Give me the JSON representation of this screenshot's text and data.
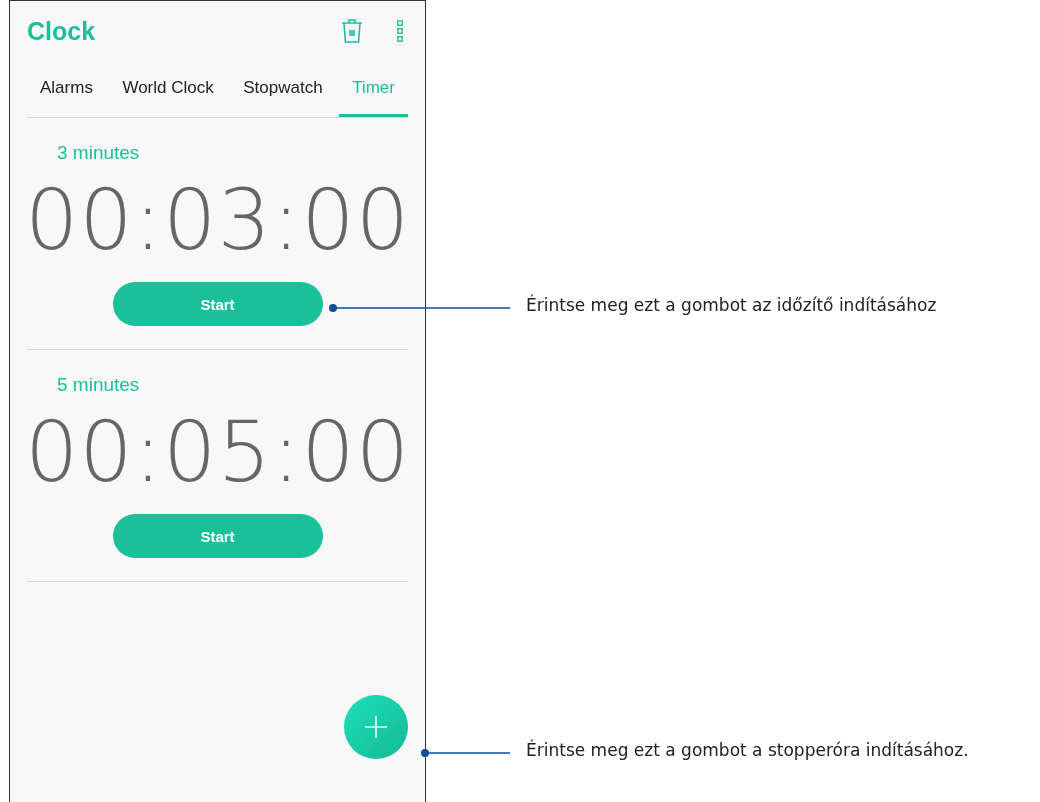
{
  "app": {
    "title": "Clock"
  },
  "tabs": [
    {
      "label": "Alarms",
      "selected": false
    },
    {
      "label": "World Clock",
      "selected": false
    },
    {
      "label": "Stopwatch",
      "selected": false
    },
    {
      "label": "Timer",
      "selected": true
    }
  ],
  "timers": [
    {
      "label": "3 minutes",
      "time": "00:03:00",
      "button": "Start"
    },
    {
      "label": "5 minutes",
      "time": "00:05:00",
      "button": "Start"
    }
  ],
  "callouts": [
    {
      "text": "Érintse meg ezt a gombot az időzítő indításához"
    },
    {
      "text": "Érintse meg ezt a gombot a stopperóra indításához."
    }
  ]
}
